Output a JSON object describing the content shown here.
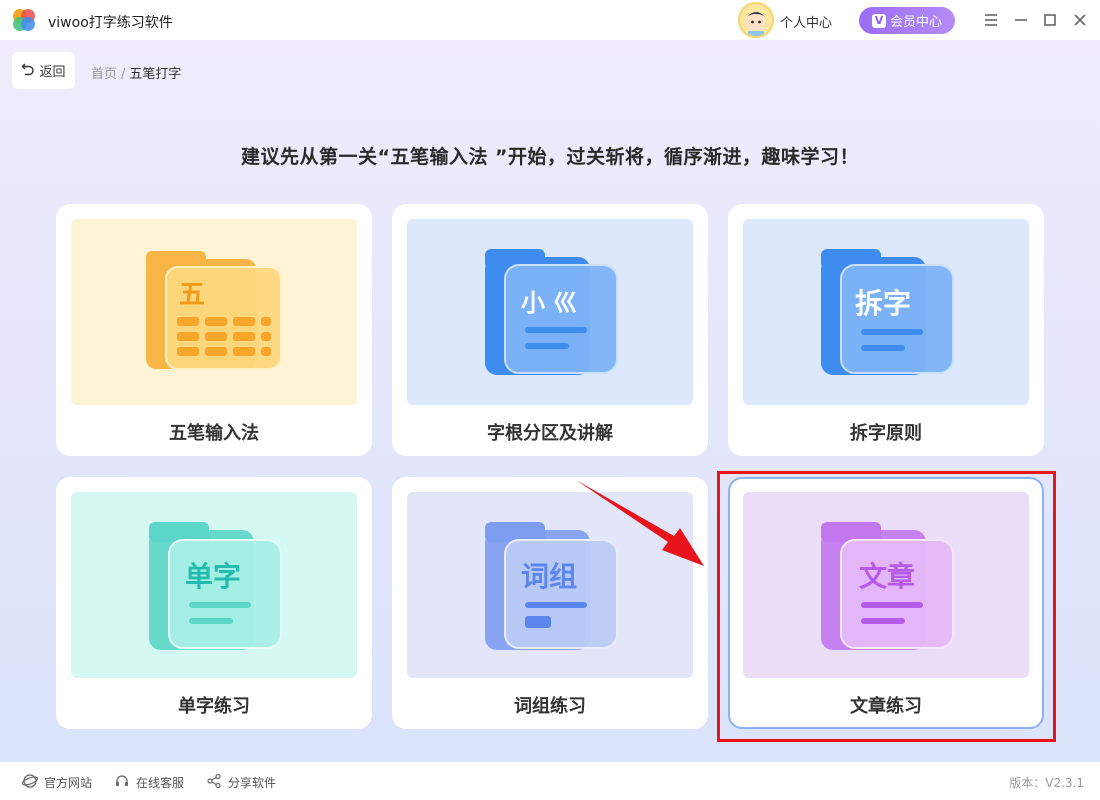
{
  "app": {
    "title": "viwoo打字练习软件",
    "user_center": "个人中心",
    "vip_badge": "V",
    "vip_label": "会员中心"
  },
  "toolbar": {
    "back_label": "返回",
    "breadcrumb": [
      "首页",
      "五笔打字"
    ],
    "breadcrumb_sep": "/"
  },
  "headline": "建议先从第一关“五笔输入法 ”开始，过关斩将，循序渐进，趣味学习！",
  "cards": [
    {
      "label": "五笔输入法",
      "icon_text": "五",
      "theme": "#f7a62e",
      "bg": "#fff3d6"
    },
    {
      "label": "字根分区及讲解",
      "icon_text": "小 巛",
      "theme": "#3f8cf0",
      "bg": "#dce9fc"
    },
    {
      "label": "拆字原则",
      "icon_text": "拆字",
      "theme": "#3f8cf0",
      "bg": "#dce9fc"
    },
    {
      "label": "单字练习",
      "icon_text": "单字",
      "theme": "#27c6b8",
      "bg": "#d6f8f3"
    },
    {
      "label": "词组练习",
      "icon_text": "词组",
      "theme": "#5b86ee",
      "bg": "#e3e6f8"
    },
    {
      "label": "文章练习",
      "icon_text": "文章",
      "theme": "#b55be8",
      "bg": "#ebdcf8"
    }
  ],
  "footer": {
    "links": [
      "官方网站",
      "在线客服",
      "分享软件"
    ],
    "version_label": "版本：",
    "version": "V2.3.1"
  },
  "colors": {
    "accent": "#9b6cf6",
    "highlight": "#e8141c",
    "selected_border": "#8fb0f5"
  }
}
